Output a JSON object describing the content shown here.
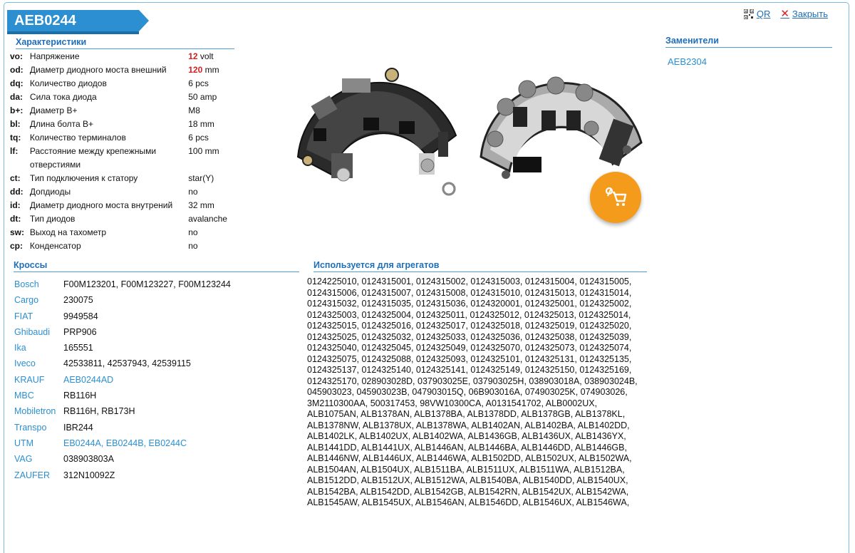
{
  "title": "AEB0244",
  "top_links": {
    "qr_label": "QR",
    "close_label": "Закрыть"
  },
  "sections": {
    "specs": "Характеристики",
    "replacements": "Заменители",
    "crosses": "Кроссы",
    "usage": "Используется для агрегатов"
  },
  "specs": [
    {
      "code": "vo:",
      "name": "Напряжение",
      "value": "12",
      "unit": " volt",
      "highlight": true
    },
    {
      "code": "od:",
      "name": "Диаметр диодного моста внешний",
      "value": "120",
      "unit": " mm",
      "highlight": true
    },
    {
      "code": "dq:",
      "name": "Количество диодов",
      "value": "6 pcs",
      "unit": "",
      "highlight": false
    },
    {
      "code": "da:",
      "name": "Сила тока диода",
      "value": "50 amp",
      "unit": "",
      "highlight": false
    },
    {
      "code": "b+:",
      "name": "Диаметр B+",
      "value": "M8",
      "unit": "",
      "highlight": false
    },
    {
      "code": "bl:",
      "name": "Длина болта B+",
      "value": "18 mm",
      "unit": "",
      "highlight": false
    },
    {
      "code": "tq:",
      "name": "Количество терминалов",
      "value": "6 pcs",
      "unit": "",
      "highlight": false
    },
    {
      "code": "lf:",
      "name": "Расстояние между крепежными отверстиями",
      "value": "100 mm",
      "unit": "",
      "highlight": false
    },
    {
      "code": "ct:",
      "name": "Тип подключения к статору",
      "value": "star(Y)",
      "unit": "",
      "highlight": false
    },
    {
      "code": "dd:",
      "name": "Допдиоды",
      "value": "no",
      "unit": "",
      "highlight": false
    },
    {
      "code": "id:",
      "name": "Диаметр диодного моста внутрений",
      "value": "32 mm",
      "unit": "",
      "highlight": false
    },
    {
      "code": "dt:",
      "name": "Тип диодов",
      "value": "avalanche",
      "unit": "",
      "highlight": false
    },
    {
      "code": "sw:",
      "name": "Выход на тахометр",
      "value": "no",
      "unit": "",
      "highlight": false
    },
    {
      "code": "cp:",
      "name": "Конденсатор",
      "value": "no",
      "unit": "",
      "highlight": false
    }
  ],
  "replacements": [
    "AEB2304"
  ],
  "crosses": [
    {
      "brand": "Bosch",
      "value": "F00M123201, F00M123227, F00M123244",
      "link": false
    },
    {
      "brand": "Cargo",
      "value": "230075",
      "link": false
    },
    {
      "brand": "FIAT",
      "value": "9949584",
      "link": false
    },
    {
      "brand": "Ghibaudi",
      "value": "PRP906",
      "link": false
    },
    {
      "brand": "Ika",
      "value": "165551",
      "link": false
    },
    {
      "brand": "Iveco",
      "value": "42533811, 42537943, 42539115",
      "link": false
    },
    {
      "brand": "KRAUF",
      "value": "AEB0244AD",
      "link": true
    },
    {
      "brand": "MBC",
      "value": "RB116H",
      "link": false
    },
    {
      "brand": "Mobiletron",
      "value": "RB116H, RB173H",
      "link": false
    },
    {
      "brand": "Transpo",
      "value": "IBR244",
      "link": false
    },
    {
      "brand": "UTM",
      "value": "EB0244A, EB0244B, EB0244C",
      "link": true
    },
    {
      "brand": "VAG",
      "value": "038903803A",
      "link": false
    },
    {
      "brand": "ZAUFER",
      "value": "312N10092Z",
      "link": false
    }
  ],
  "usage_text": "0124225010, 0124315001, 0124315002, 0124315003, 0124315004, 0124315005, 0124315006, 0124315007, 0124315008, 0124315010, 0124315013, 0124315014, 0124315032, 0124315035, 0124315036, 0124320001, 0124325001, 0124325002, 0124325003, 0124325004, 0124325011, 0124325012, 0124325013, 0124325014, 0124325015, 0124325016, 0124325017, 0124325018, 0124325019, 0124325020, 0124325025, 0124325032, 0124325033, 0124325036, 0124325038, 0124325039, 0124325040, 0124325045, 0124325049, 0124325070, 0124325073, 0124325074, 0124325075, 0124325088, 0124325093, 0124325101, 0124325131, 0124325135, 0124325137, 0124325140, 0124325141, 0124325149, 0124325150, 0124325169, 0124325170, 028903028D, 037903025E, 037903025H, 038903018A, 038903024B, 045903023, 045903023B, 047903015Q, 06B903016A, 074903025K, 074903026, 3M2110300AA, 500317453, 98VW10300CA, A0131541702, ALB0002UX, ALB1075AN, ALB1378AN, ALB1378BA, ALB1378DD, ALB1378GB, ALB1378KL, ALB1378NW, ALB1378UX, ALB1378WA, ALB1402AN, ALB1402BA, ALB1402DD, ALB1402LK, ALB1402UX, ALB1402WA, ALB1436GB, ALB1436UX, ALB1436YX, ALB1441DD, ALB1441UX, ALB1446AN, ALB1446BA, ALB1446DD, ALB1446GB, ALB1446NW, ALB1446UX, ALB1446WA, ALB1502DD, ALB1502UX, ALB1502WA, ALB1504AN, ALB1504UX, ALB1511BA, ALB1511UX, ALB1511WA, ALB1512BA, ALB1512DD, ALB1512UX, ALB1512WA, ALB1540BA, ALB1540DD, ALB1540UX, ALB1542BA, ALB1542DD, ALB1542GB, ALB1542RN, ALB1542UX, ALB1542WA, ALB1545AW, ALB1545UX, ALB1546AN, ALB1546DD, ALB1546UX, ALB1546WA,",
  "colors": {
    "accent": "#2b8fd1",
    "highlight": "#d42020",
    "cart": "#f59b1b"
  }
}
